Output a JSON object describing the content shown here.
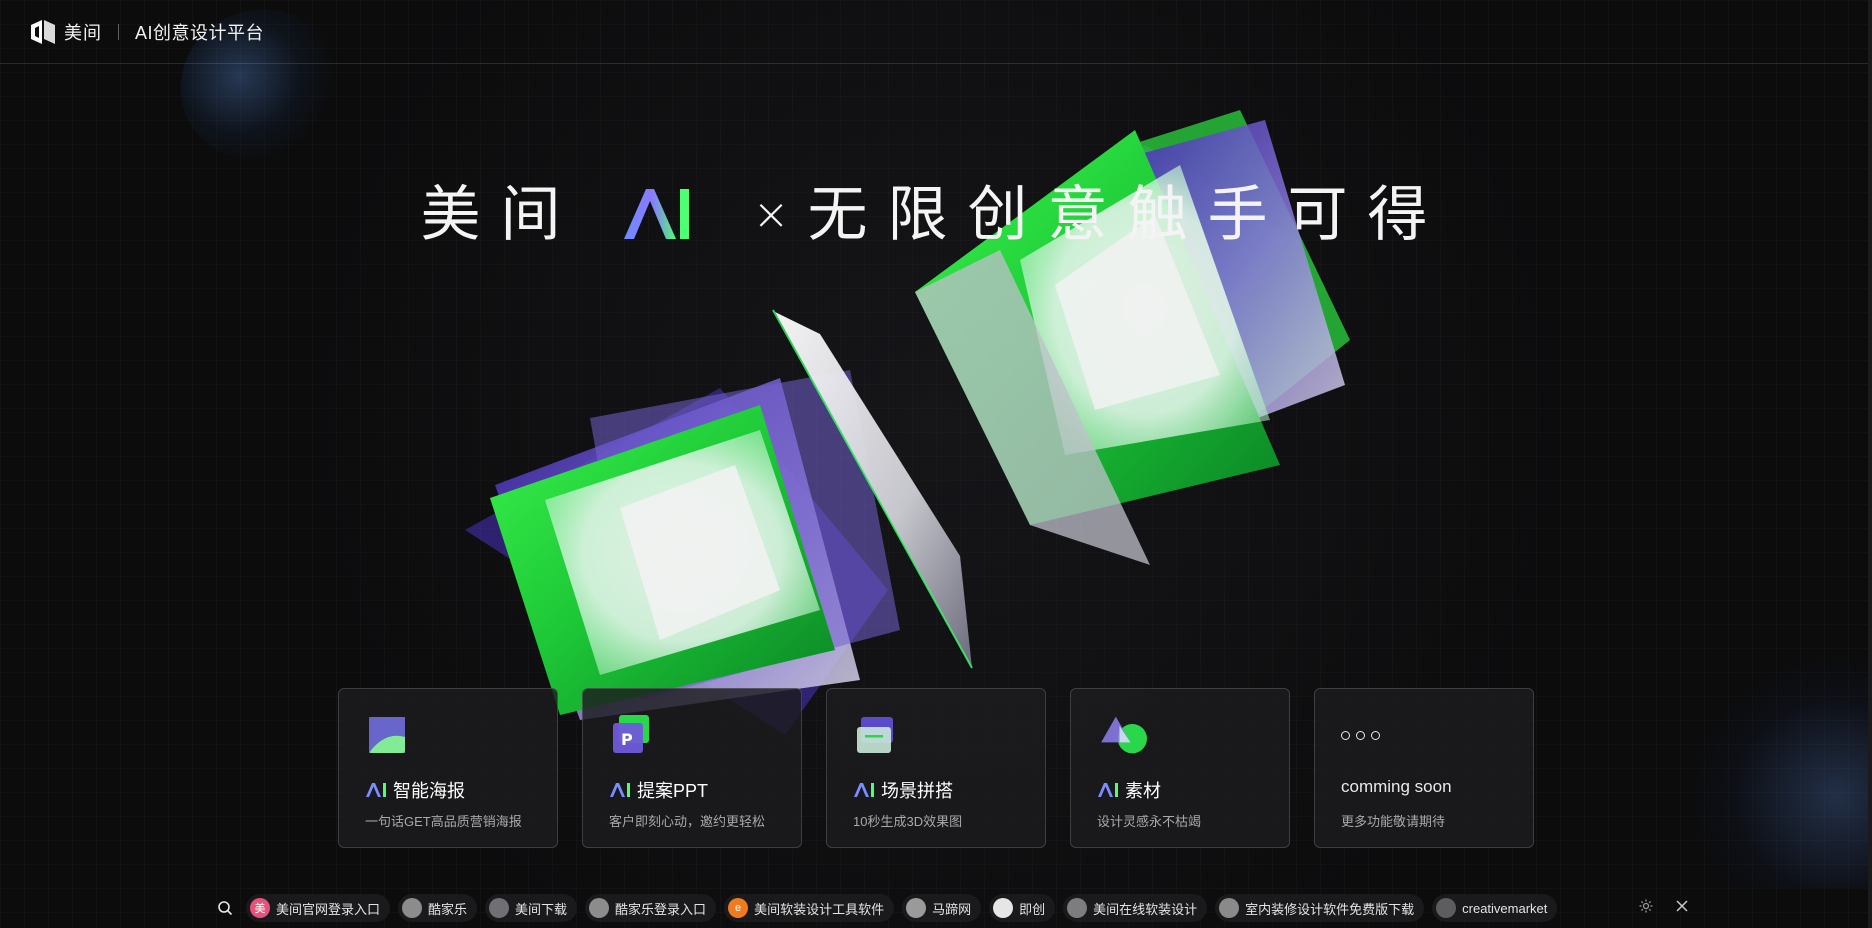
{
  "header": {
    "brand_name": "美间",
    "platform_title": "AI创意设计平台"
  },
  "hero": {
    "title_prefix": "美间",
    "title_ai": "AI",
    "title_times": "×",
    "title_suffix": "无限创意触手可得"
  },
  "cards": [
    {
      "title": "智能海报",
      "has_ai_tag": true,
      "description": "一句话GET高品质营销海报",
      "icon": "poster-icon"
    },
    {
      "title": "提案PPT",
      "has_ai_tag": true,
      "description": "客户即刻心动，邀约更轻松",
      "icon": "ppt-icon"
    },
    {
      "title": "场景拼搭",
      "has_ai_tag": true,
      "description": "10秒生成3D效果图",
      "icon": "scene-icon"
    },
    {
      "title": "素材",
      "has_ai_tag": true,
      "description": "设计灵感永不枯竭",
      "icon": "material-icon"
    },
    {
      "title": "comming soon",
      "has_ai_tag": false,
      "description": "更多功能敬请期待",
      "icon": "more-dots-icon"
    }
  ],
  "linkbar": {
    "items": [
      {
        "label": "美间官网登录入口",
        "fav_text": "美",
        "fav_color": "#e8527a"
      },
      {
        "label": "酷家乐",
        "fav_text": "",
        "fav_color": "#8c8c8c"
      },
      {
        "label": "美间下载",
        "fav_text": "",
        "fav_color": "#6f6f74"
      },
      {
        "label": "酷家乐登录入口",
        "fav_text": "",
        "fav_color": "#8c8c8c"
      },
      {
        "label": "美间软装设计工具软件",
        "fav_text": "e",
        "fav_color": "#f07a1e"
      },
      {
        "label": "马蹄网",
        "fav_text": "",
        "fav_color": "#9a9a9a"
      },
      {
        "label": "即创",
        "fav_text": "",
        "fav_color": "#e6e6e6"
      },
      {
        "label": "美间在线软装设计",
        "fav_text": "",
        "fav_color": "#7d7d80"
      },
      {
        "label": "室内装修设计软件免费版下载",
        "fav_text": "",
        "fav_color": "#8a8a8a"
      },
      {
        "label": "creativemarket",
        "fav_text": "",
        "fav_color": "#5d5d60"
      }
    ]
  },
  "colors": {
    "background": "#0c0c0d",
    "accent_green": "#2bff4a",
    "accent_purple": "#5a3bd6",
    "accent_blue": "#4b7bff"
  }
}
